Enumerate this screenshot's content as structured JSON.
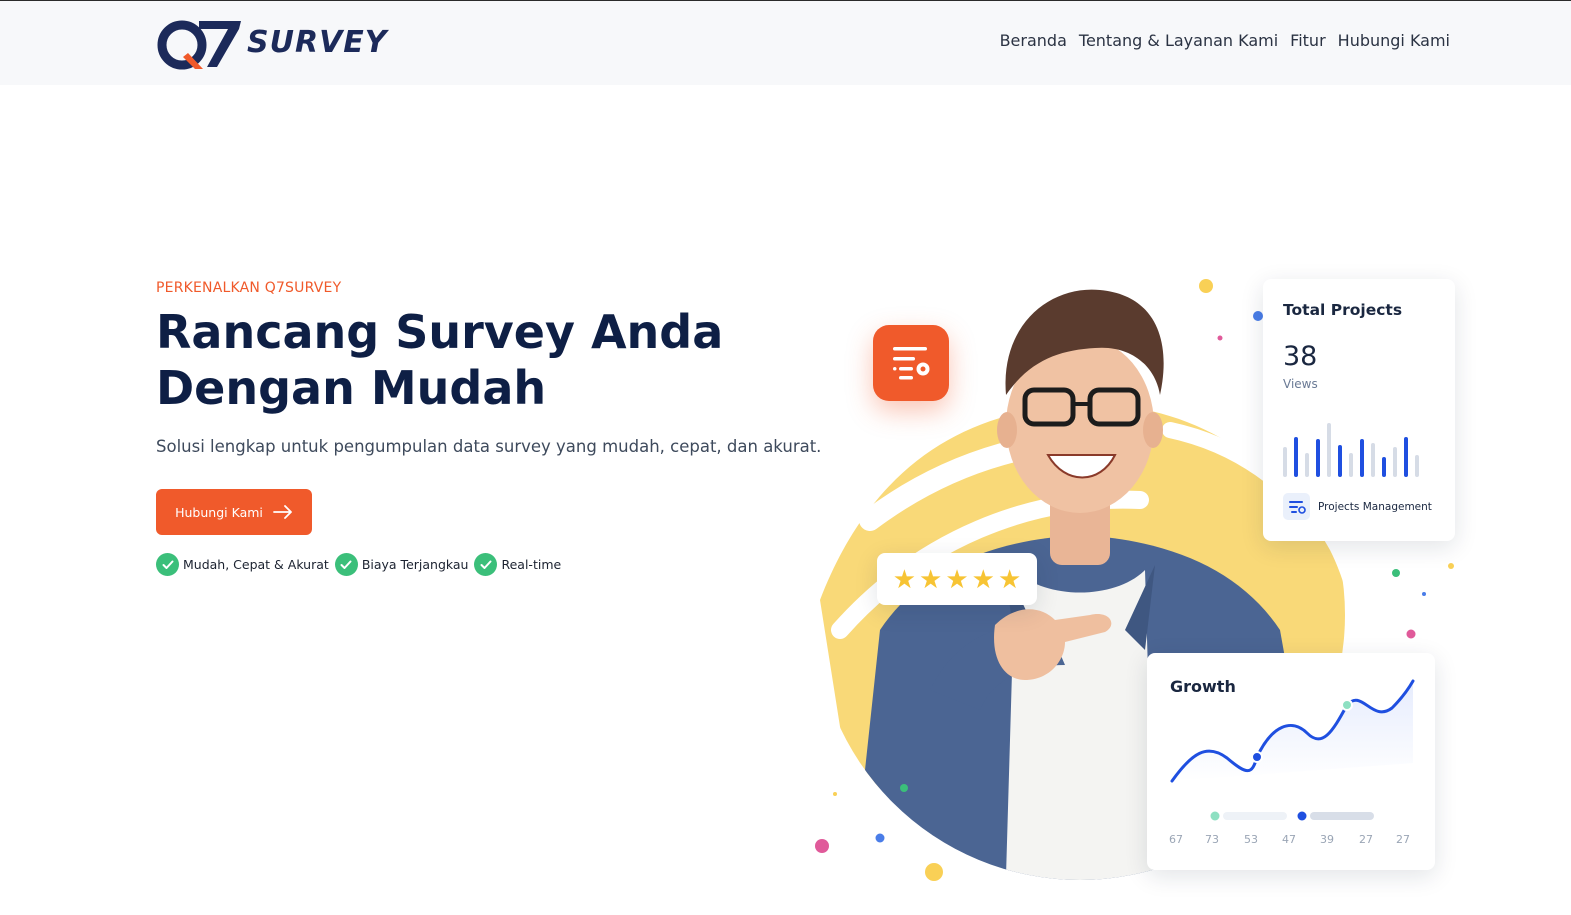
{
  "brand": {
    "name": "SURVEY",
    "mark": "Q7",
    "colors": {
      "navy": "#1c2a5a",
      "orange": "#f05a2b",
      "green": "#3bbf7a",
      "blue": "#1f4fe0",
      "yellow": "#f9d978"
    }
  },
  "nav": {
    "items": [
      "Beranda",
      "Tentang & Layanan Kami",
      "Fitur",
      "Hubungi Kami"
    ]
  },
  "hero": {
    "eyebrow": "PERKENALKAN Q7SURVEY",
    "title_line1": "Rancang Survey Anda",
    "title_line2": "Dengan Mudah",
    "subtitle": "Solusi lengkap untuk pengumpulan data survey yang mudah, cepat, dan akurat.",
    "cta_label": "Hubungi Kami",
    "cta_icon": "arrow-right-icon",
    "features": [
      "Mudah, Cepat & Akurat",
      "Biaya Terjangkau",
      "Real-time"
    ]
  },
  "illustration": {
    "rating_stars": 5,
    "badge_icon": "survey-settings-icon",
    "total_projects": {
      "title": "Total Projects",
      "value": "38",
      "unit": "Views",
      "footer_label": "Projects Management",
      "footer_icon": "projects-management-icon"
    },
    "growth": {
      "title": "Growth",
      "tick_labels": [
        "67",
        "73",
        "53",
        "47",
        "39",
        "27",
        "27"
      ]
    }
  }
}
